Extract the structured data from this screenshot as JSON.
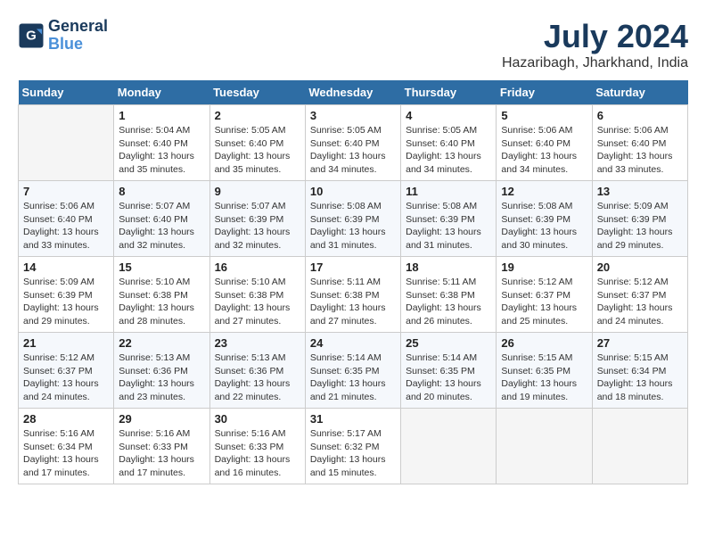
{
  "logo": {
    "line1": "General",
    "line2": "Blue"
  },
  "title": "July 2024",
  "subtitle": "Hazaribagh, Jharkhand, India",
  "weekdays": [
    "Sunday",
    "Monday",
    "Tuesday",
    "Wednesday",
    "Thursday",
    "Friday",
    "Saturday"
  ],
  "weeks": [
    [
      {
        "day": null
      },
      {
        "day": 1,
        "sunrise": "5:04 AM",
        "sunset": "6:40 PM",
        "daylight": "13 hours and 35 minutes."
      },
      {
        "day": 2,
        "sunrise": "5:05 AM",
        "sunset": "6:40 PM",
        "daylight": "13 hours and 35 minutes."
      },
      {
        "day": 3,
        "sunrise": "5:05 AM",
        "sunset": "6:40 PM",
        "daylight": "13 hours and 34 minutes."
      },
      {
        "day": 4,
        "sunrise": "5:05 AM",
        "sunset": "6:40 PM",
        "daylight": "13 hours and 34 minutes."
      },
      {
        "day": 5,
        "sunrise": "5:06 AM",
        "sunset": "6:40 PM",
        "daylight": "13 hours and 34 minutes."
      },
      {
        "day": 6,
        "sunrise": "5:06 AM",
        "sunset": "6:40 PM",
        "daylight": "13 hours and 33 minutes."
      }
    ],
    [
      {
        "day": 7,
        "sunrise": "5:06 AM",
        "sunset": "6:40 PM",
        "daylight": "13 hours and 33 minutes."
      },
      {
        "day": 8,
        "sunrise": "5:07 AM",
        "sunset": "6:40 PM",
        "daylight": "13 hours and 32 minutes."
      },
      {
        "day": 9,
        "sunrise": "5:07 AM",
        "sunset": "6:39 PM",
        "daylight": "13 hours and 32 minutes."
      },
      {
        "day": 10,
        "sunrise": "5:08 AM",
        "sunset": "6:39 PM",
        "daylight": "13 hours and 31 minutes."
      },
      {
        "day": 11,
        "sunrise": "5:08 AM",
        "sunset": "6:39 PM",
        "daylight": "13 hours and 31 minutes."
      },
      {
        "day": 12,
        "sunrise": "5:08 AM",
        "sunset": "6:39 PM",
        "daylight": "13 hours and 30 minutes."
      },
      {
        "day": 13,
        "sunrise": "5:09 AM",
        "sunset": "6:39 PM",
        "daylight": "13 hours and 29 minutes."
      }
    ],
    [
      {
        "day": 14,
        "sunrise": "5:09 AM",
        "sunset": "6:39 PM",
        "daylight": "13 hours and 29 minutes."
      },
      {
        "day": 15,
        "sunrise": "5:10 AM",
        "sunset": "6:38 PM",
        "daylight": "13 hours and 28 minutes."
      },
      {
        "day": 16,
        "sunrise": "5:10 AM",
        "sunset": "6:38 PM",
        "daylight": "13 hours and 27 minutes."
      },
      {
        "day": 17,
        "sunrise": "5:11 AM",
        "sunset": "6:38 PM",
        "daylight": "13 hours and 27 minutes."
      },
      {
        "day": 18,
        "sunrise": "5:11 AM",
        "sunset": "6:38 PM",
        "daylight": "13 hours and 26 minutes."
      },
      {
        "day": 19,
        "sunrise": "5:12 AM",
        "sunset": "6:37 PM",
        "daylight": "13 hours and 25 minutes."
      },
      {
        "day": 20,
        "sunrise": "5:12 AM",
        "sunset": "6:37 PM",
        "daylight": "13 hours and 24 minutes."
      }
    ],
    [
      {
        "day": 21,
        "sunrise": "5:12 AM",
        "sunset": "6:37 PM",
        "daylight": "13 hours and 24 minutes."
      },
      {
        "day": 22,
        "sunrise": "5:13 AM",
        "sunset": "6:36 PM",
        "daylight": "13 hours and 23 minutes."
      },
      {
        "day": 23,
        "sunrise": "5:13 AM",
        "sunset": "6:36 PM",
        "daylight": "13 hours and 22 minutes."
      },
      {
        "day": 24,
        "sunrise": "5:14 AM",
        "sunset": "6:35 PM",
        "daylight": "13 hours and 21 minutes."
      },
      {
        "day": 25,
        "sunrise": "5:14 AM",
        "sunset": "6:35 PM",
        "daylight": "13 hours and 20 minutes."
      },
      {
        "day": 26,
        "sunrise": "5:15 AM",
        "sunset": "6:35 PM",
        "daylight": "13 hours and 19 minutes."
      },
      {
        "day": 27,
        "sunrise": "5:15 AM",
        "sunset": "6:34 PM",
        "daylight": "13 hours and 18 minutes."
      }
    ],
    [
      {
        "day": 28,
        "sunrise": "5:16 AM",
        "sunset": "6:34 PM",
        "daylight": "13 hours and 17 minutes."
      },
      {
        "day": 29,
        "sunrise": "5:16 AM",
        "sunset": "6:33 PM",
        "daylight": "13 hours and 17 minutes."
      },
      {
        "day": 30,
        "sunrise": "5:16 AM",
        "sunset": "6:33 PM",
        "daylight": "13 hours and 16 minutes."
      },
      {
        "day": 31,
        "sunrise": "5:17 AM",
        "sunset": "6:32 PM",
        "daylight": "13 hours and 15 minutes."
      },
      {
        "day": null
      },
      {
        "day": null
      },
      {
        "day": null
      }
    ]
  ]
}
